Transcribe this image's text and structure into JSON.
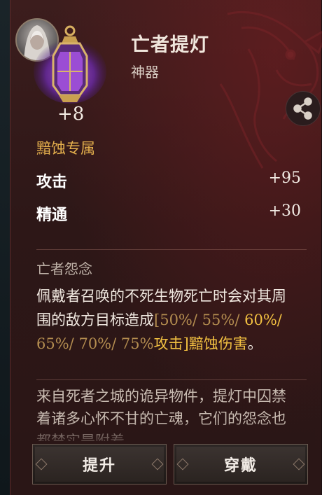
{
  "header": {
    "tab_title": ""
  },
  "item": {
    "name": "亡者提灯",
    "type": "神器",
    "level": "+8",
    "exclusive": "黯蚀专属"
  },
  "stats": [
    {
      "label": "攻击",
      "value": "+95"
    },
    {
      "label": "精通",
      "value": "+30"
    }
  ],
  "skill": {
    "name": "亡者怨念",
    "desc_part1": "佩戴者召唤的不死生物死亡时会对其周围的敌方目标造成",
    "bracket_open": "[",
    "pct1": "50%/",
    "pct2": "55%/",
    "pct3": "60%/",
    "pct4": "65%/",
    "pct5": "70%/",
    "pct6": "75%",
    "attack": "攻击",
    "bracket_close": "]",
    "dmg_type": "黯蚀伤害",
    "period": "。"
  },
  "lore": "来自死者之城的诡异物件，提灯中囚禁着诸多心怀不甘的亡魂，它们的怨念也都禁实是附着",
  "buttons": {
    "upgrade": "提升",
    "equip": "穿戴"
  },
  "icons": {
    "share": "share-icon"
  },
  "colors": {
    "accent": "#e5b04d",
    "highlight": "#f2c041",
    "panel": "#2d1717"
  }
}
